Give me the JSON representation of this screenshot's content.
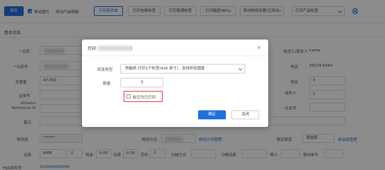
{
  "toolbar": {
    "save_label": "保存",
    "export_images_label": "导出图片",
    "export_products_label": "导出产品明细",
    "print_pick_label": "打印拣货单",
    "print_box_label": "打印包裹标签",
    "print_normal_label": "打印普通标签",
    "print_ladder_label": "打印箱提(BOL)",
    "export_logistics_label": "导出物流发票(已导出)",
    "print_product_label_value": "打印产品标签"
  },
  "form": {
    "section_title": "基本信息",
    "labels": {
      "warehouse": "仓库",
      "outbound_warehouse": "出库仓",
      "total_weight": "总重量",
      "shipment_no": "运单号",
      "reference_id": "Amazon Reference ID",
      "remark": "备注",
      "logistics": "物流商",
      "logistics_method": "物流方式",
      "logistics_channel": "物流渠道",
      "freight": "运费",
      "tax": "税金",
      "surcharge": "杂费",
      "other": "其他",
      "billing": "分摊方式",
      "alloc_freight": "分摊运费",
      "declared": "预计",
      "declared_tax": "报出单号",
      "fba_shipment_id": "FBA货件号",
      "packing": "装箱方式",
      "contact": "收货人/联系人",
      "address": "地址",
      "phone": "电话",
      "receiver": "收件人",
      "warehouse_code": "仓库号"
    },
    "values": {
      "total_weight": "47.000",
      "freight_currency": "RMB",
      "freight": "0",
      "tax": "0.00",
      "surcharge": "0.00",
      "other": "0",
      "right_3": "3",
      "right_3b": "3",
      "phone_tail": "95219-8364",
      "right_name": "hame"
    },
    "links": {
      "logistics_manage": "物流方式管理",
      "channel_manage": "承运商管理",
      "bottom_link": "SO3048058999"
    },
    "select_placeholder": "请选择"
  },
  "modal": {
    "title": "打印",
    "title_suffix": ")",
    "close_glyph": "×",
    "paper_label": "纸张类型",
    "paper_value": "热敏纸 打印1个标签(4x6 英寸) , 支持所有国家",
    "qty_label": "数量",
    "qty_value": "3",
    "mark_printed_label": "标记为已打印",
    "ok_label": "确定",
    "cancel_label": "关闭"
  },
  "icons": {
    "settings": "settings-icon",
    "dropdown": "chevron-down-icon",
    "close": "close-icon"
  },
  "colors": {
    "primary": "#1f6fde",
    "highlight": "#e53935"
  }
}
